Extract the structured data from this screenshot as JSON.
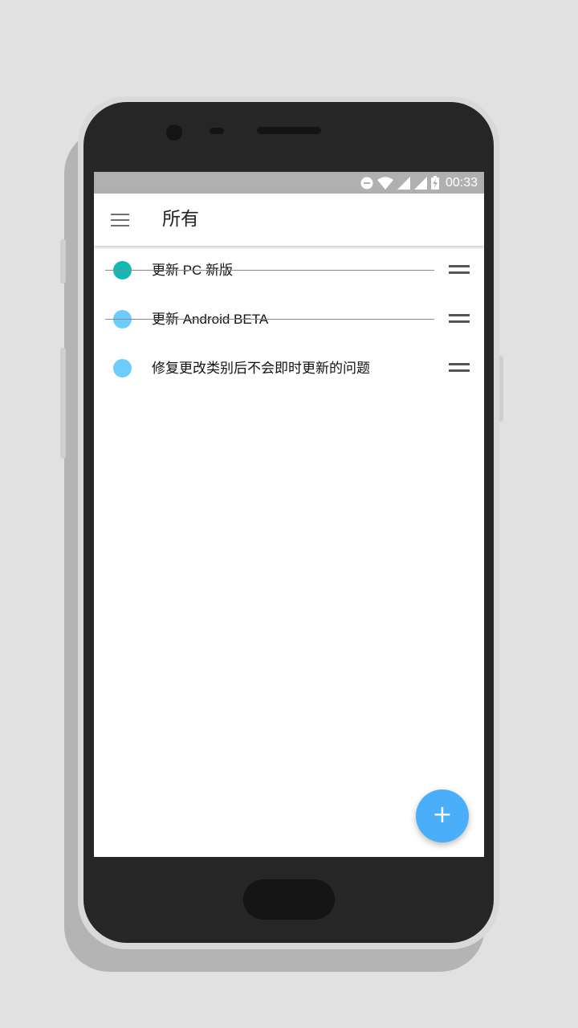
{
  "status_bar": {
    "time": "00:33",
    "icons": [
      "do-not-disturb-icon",
      "wifi-icon",
      "signal-icon",
      "signal-icon",
      "battery-charging-icon"
    ]
  },
  "app_bar": {
    "title": "所有",
    "menu_icon": "hamburger-menu-icon"
  },
  "tasks": [
    {
      "text": "更新 PC 新版",
      "color": "#14b8b3",
      "completed": true
    },
    {
      "text": "更新 Android BETA",
      "color": "#6dcdfa",
      "completed": true
    },
    {
      "text": "修复更改类别后不会即时更新的问题",
      "color": "#6dcdfa",
      "completed": false
    }
  ],
  "fab": {
    "icon": "plus-icon",
    "glyph": "+",
    "color": "#4aaef8"
  }
}
